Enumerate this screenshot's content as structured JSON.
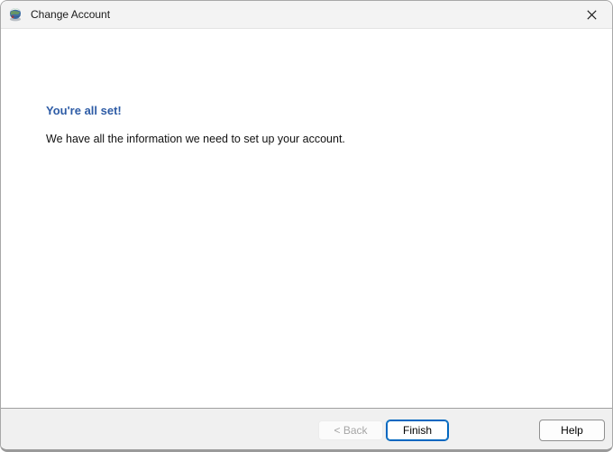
{
  "window": {
    "title": "Change Account"
  },
  "icons": {
    "app_icon": "globe-account-icon",
    "close_icon": "close-x"
  },
  "content": {
    "heading": "You're all set!",
    "body": "We have all the information we need to set up your account."
  },
  "footer": {
    "back_label": "< Back",
    "finish_label": "Finish",
    "help_label": "Help"
  },
  "colors": {
    "heading_text": "#2e5ca6",
    "finish_button_border": "#0067c0",
    "titlebar_background": "#f3f3f3",
    "footer_background": "#f0f0f0",
    "footer_divider": "#a0a0a0",
    "window_border": "#a8a8a8",
    "disabled_button_text": "#a6a6a6"
  }
}
